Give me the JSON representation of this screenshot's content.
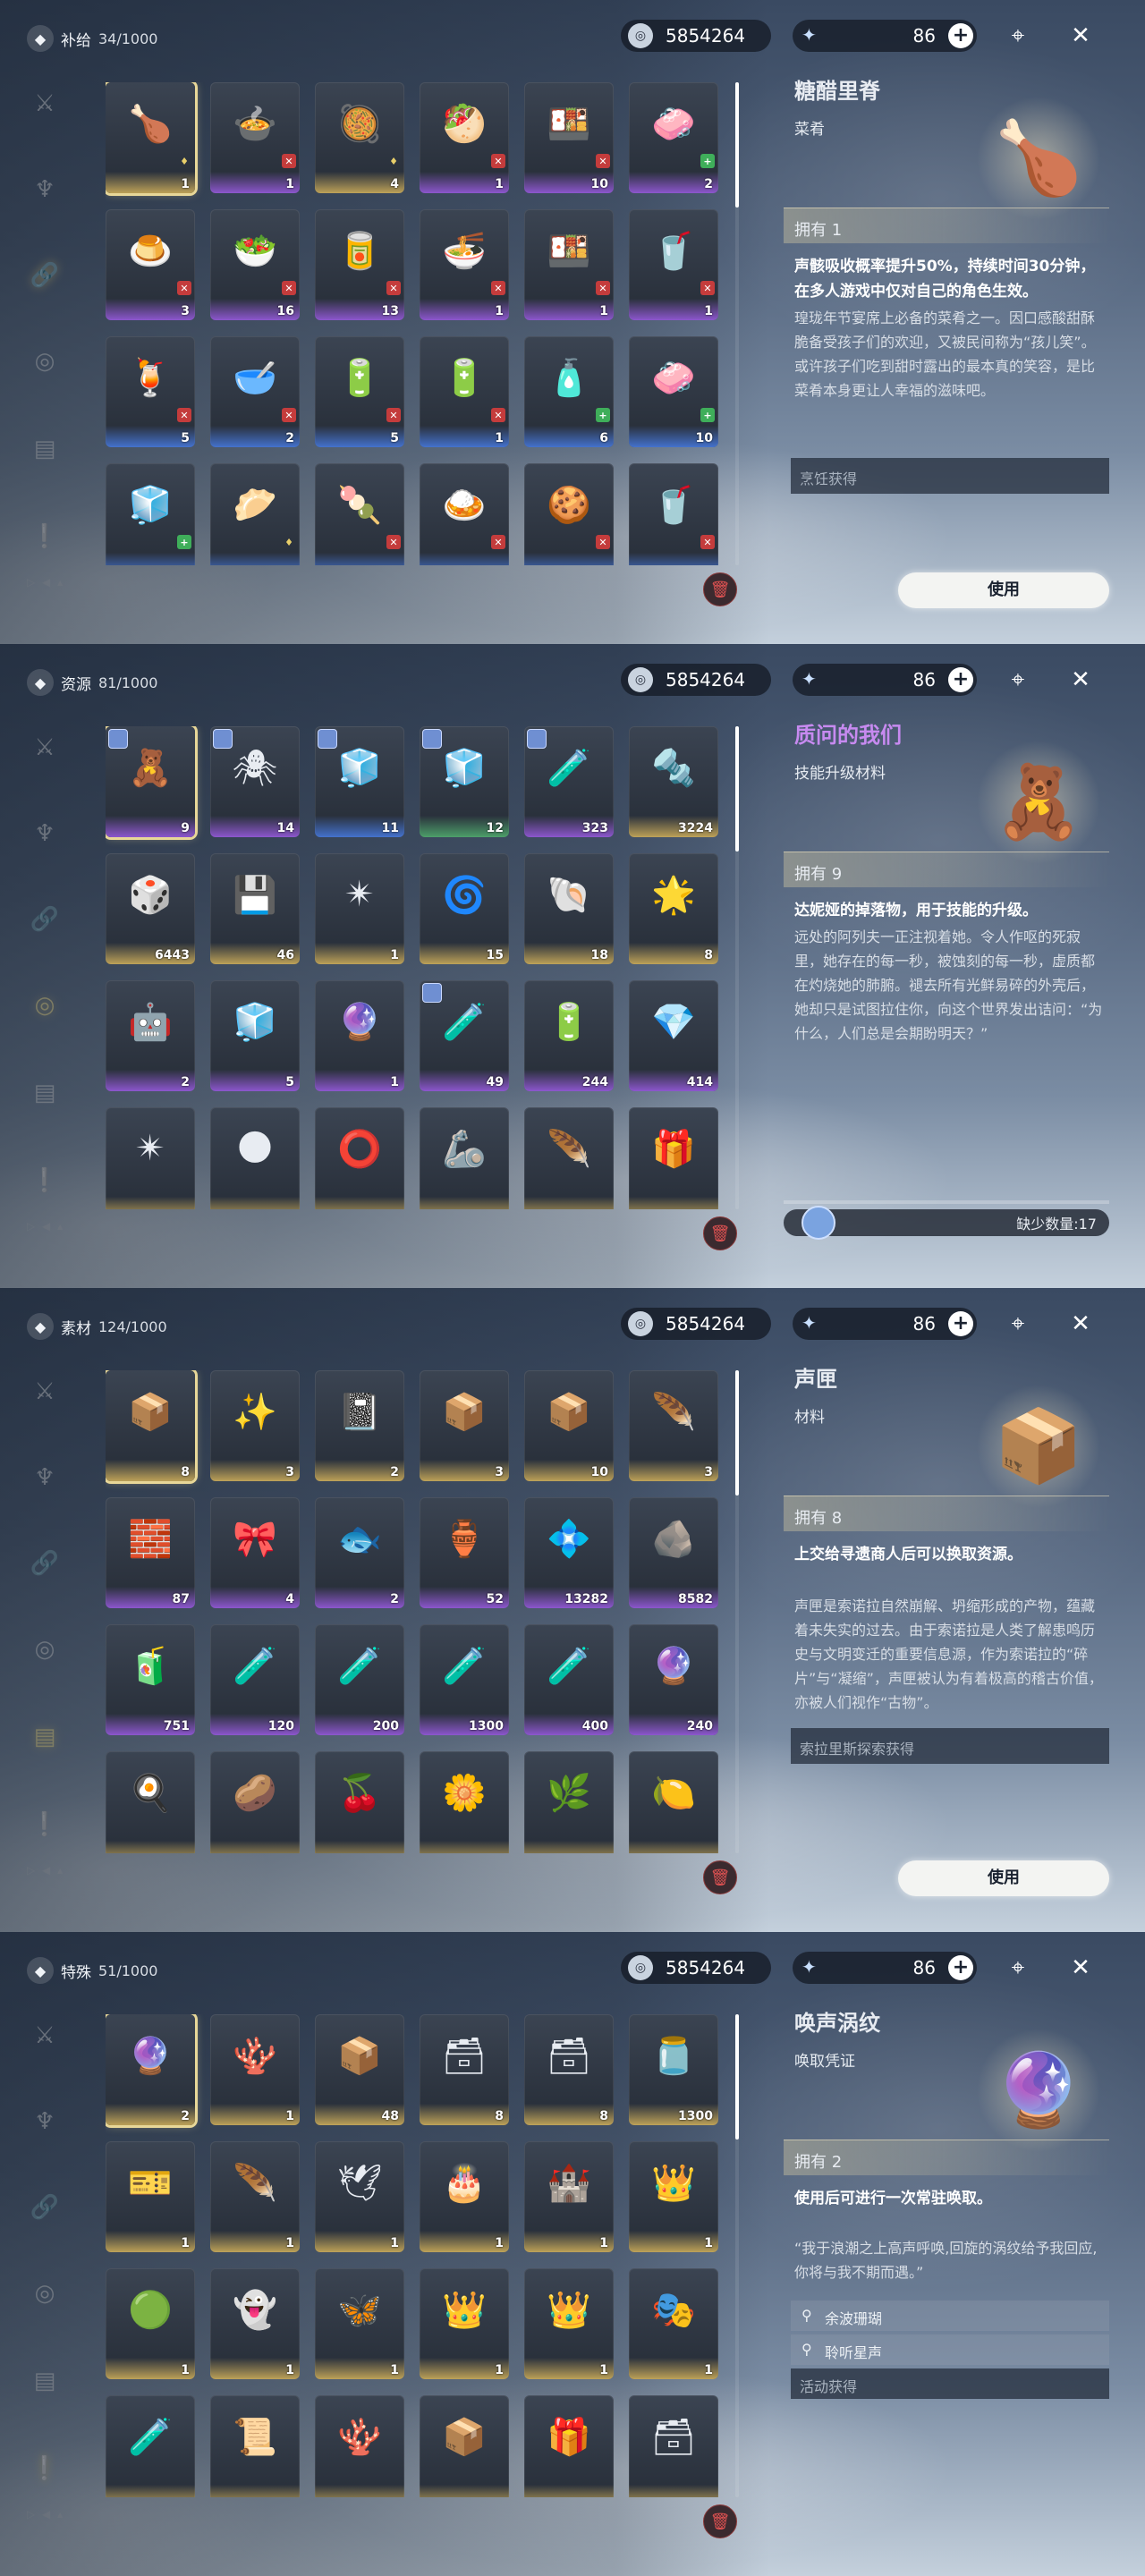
{
  "accent": {
    "gold": "#e8d798",
    "purple_name": "#c78af0",
    "trash": "#e05252"
  },
  "panels": [
    {
      "category": "补给",
      "count": "34/1000",
      "currency": "5854264",
      "stamina": "86",
      "items": [
        {
          "icon": "🍗",
          "qty": "1",
          "q": "gold",
          "b": "gold"
        },
        {
          "icon": "🍲",
          "qty": "1",
          "q": "purple",
          "b": "red"
        },
        {
          "icon": "🥘",
          "qty": "4",
          "q": "gold",
          "b": "gold"
        },
        {
          "icon": "🥙",
          "qty": "1",
          "q": "purple",
          "b": "red"
        },
        {
          "icon": "🍱",
          "qty": "10",
          "q": "purple",
          "b": "red"
        },
        {
          "icon": "🧼",
          "qty": "2",
          "q": "purple",
          "b": "green"
        },
        {
          "icon": "🍮",
          "qty": "3",
          "q": "purple",
          "b": "red"
        },
        {
          "icon": "🥗",
          "qty": "16",
          "q": "purple",
          "b": "red"
        },
        {
          "icon": "🥫",
          "qty": "13",
          "q": "purple",
          "b": "red"
        },
        {
          "icon": "🍜",
          "qty": "1",
          "q": "purple",
          "b": "red"
        },
        {
          "icon": "🍱",
          "qty": "1",
          "q": "purple",
          "b": "red"
        },
        {
          "icon": "🥤",
          "qty": "1",
          "q": "purple",
          "b": "red"
        },
        {
          "icon": "🍹",
          "qty": "5",
          "q": "blue",
          "b": "red"
        },
        {
          "icon": "🥣",
          "qty": "2",
          "q": "blue",
          "b": "red"
        },
        {
          "icon": "🔋",
          "qty": "5",
          "q": "blue",
          "b": "red"
        },
        {
          "icon": "🔋",
          "qty": "1",
          "q": "blue",
          "b": "red"
        },
        {
          "icon": "🧴",
          "qty": "6",
          "q": "blue",
          "b": "green"
        },
        {
          "icon": "🧼",
          "qty": "10",
          "q": "blue",
          "b": "green"
        },
        {
          "icon": "🧊",
          "qty": "",
          "q": "blue",
          "b": "green"
        },
        {
          "icon": "🥟",
          "qty": "",
          "q": "blue",
          "b": "gold"
        },
        {
          "icon": "🍡",
          "qty": "",
          "q": "blue",
          "b": "red"
        },
        {
          "icon": "🍛",
          "qty": "",
          "q": "blue",
          "b": "red"
        },
        {
          "icon": "🍪",
          "qty": "",
          "q": "blue",
          "b": "red"
        },
        {
          "icon": "🥤",
          "qty": "",
          "q": "blue",
          "b": "red"
        }
      ],
      "detail": {
        "name": "糖醋里脊",
        "type": "菜肴",
        "img": "🍗",
        "owned": "拥有 1",
        "effect": "声骸吸收概率提升50%，持续时间30分钟，在多人游戏中仅对自己的角色生效。",
        "desc": "瑝珑年节宴席上必备的菜肴之一。因口感酸甜酥脆备受孩子们的欢迎，又被民间称为“孩儿笑”。或许孩子们吃到甜时露出的最本真的笑容，是比菜肴本身更让人幸福的滋味吧。",
        "source": "烹饪获得",
        "use": "使用"
      }
    },
    {
      "category": "资源",
      "count": "81/1000",
      "currency": "5854264",
      "stamina": "86",
      "items": [
        {
          "icon": "🧸",
          "qty": "9",
          "q": "purple",
          "t": true
        },
        {
          "icon": "🕷",
          "qty": "14",
          "q": "purple",
          "t": true
        },
        {
          "icon": "🧊",
          "qty": "11",
          "q": "blue",
          "t": true
        },
        {
          "icon": "🧊",
          "qty": "12",
          "q": "green",
          "t": true
        },
        {
          "icon": "🧪",
          "qty": "323",
          "q": "purple",
          "t": true
        },
        {
          "icon": "🔩",
          "qty": "3224",
          "q": "gold"
        },
        {
          "icon": "🎲",
          "qty": "6443",
          "q": "gold"
        },
        {
          "icon": "💾",
          "qty": "46",
          "q": "gold"
        },
        {
          "icon": "✴",
          "qty": "1",
          "q": "gold"
        },
        {
          "icon": "🌀",
          "qty": "15",
          "q": "gold"
        },
        {
          "icon": "🐚",
          "qty": "18",
          "q": "gold"
        },
        {
          "icon": "🌟",
          "qty": "8",
          "q": "gold"
        },
        {
          "icon": "🤖",
          "qty": "2",
          "q": "purple"
        },
        {
          "icon": "🧊",
          "qty": "5",
          "q": "purple"
        },
        {
          "icon": "🔮",
          "qty": "1",
          "q": "purple"
        },
        {
          "icon": "🧪",
          "qty": "49",
          "q": "purple",
          "t": true
        },
        {
          "icon": "🔋",
          "qty": "244",
          "q": "purple"
        },
        {
          "icon": "💎",
          "qty": "414",
          "q": "purple"
        },
        {
          "icon": "✴",
          "qty": "",
          "q": "gold"
        },
        {
          "icon": "🌑",
          "qty": "",
          "q": "gold"
        },
        {
          "icon": "⭕",
          "qty": "",
          "q": "gold"
        },
        {
          "icon": "🦾",
          "qty": "",
          "q": "gold"
        },
        {
          "icon": "🪶",
          "qty": "",
          "q": "gold"
        },
        {
          "icon": "🎁",
          "qty": "",
          "q": "gold"
        }
      ],
      "detail": {
        "name": "质问的我们",
        "type": "技能升级材料",
        "img": "🧸",
        "owned": "拥有 9",
        "effect": "达妮娅的掉落物，用于技能的升级。",
        "desc": "远处的阿列夫一正注视着她。令人作呕的死寂里，她存在的每一秒，被蚀刻的每一秒，虚质都在灼烧她的肺腑。褪去所有光鲜易碎的外壳后，她却只是试图拉住你，向这个世界发出诘问：“为什么，人们总是会期盼明天？”",
        "lack": "缺少数量:17"
      }
    },
    {
      "category": "素材",
      "count": "124/1000",
      "currency": "5854264",
      "stamina": "86",
      "items": [
        {
          "icon": "📦",
          "qty": "8",
          "q": "gold"
        },
        {
          "icon": "✨",
          "qty": "3",
          "q": "gold"
        },
        {
          "icon": "📓",
          "qty": "2",
          "q": "gold"
        },
        {
          "icon": "📦",
          "qty": "3",
          "q": "gold"
        },
        {
          "icon": "📦",
          "qty": "10",
          "q": "gold"
        },
        {
          "icon": "🪶",
          "qty": "3",
          "q": "gold"
        },
        {
          "icon": "🧱",
          "qty": "87",
          "q": "purple"
        },
        {
          "icon": "🎀",
          "qty": "4",
          "q": "purple"
        },
        {
          "icon": "🐟",
          "qty": "2",
          "q": "purple"
        },
        {
          "icon": "🏺",
          "qty": "52",
          "q": "purple"
        },
        {
          "icon": "💠",
          "qty": "13282",
          "q": "purple"
        },
        {
          "icon": "🪨",
          "qty": "8582",
          "q": "purple"
        },
        {
          "icon": "🧃",
          "qty": "751",
          "q": "purple"
        },
        {
          "icon": "🧪",
          "qty": "120",
          "q": "purple"
        },
        {
          "icon": "🧪",
          "qty": "200",
          "q": "purple"
        },
        {
          "icon": "🧪",
          "qty": "1300",
          "q": "purple"
        },
        {
          "icon": "🧪",
          "qty": "400",
          "q": "purple"
        },
        {
          "icon": "🔮",
          "qty": "240",
          "q": "purple"
        },
        {
          "icon": "🍳",
          "qty": "",
          "q": "gold"
        },
        {
          "icon": "🥔",
          "qty": "",
          "q": "gold"
        },
        {
          "icon": "🍒",
          "qty": "",
          "q": "gold"
        },
        {
          "icon": "🌼",
          "qty": "",
          "q": "gold"
        },
        {
          "icon": "🌿",
          "qty": "",
          "q": "gold"
        },
        {
          "icon": "🍋",
          "qty": "",
          "q": "gold"
        }
      ],
      "detail": {
        "name": "声匣",
        "type": "材料",
        "img": "📦",
        "owned": "拥有 8",
        "effect": "上交给寻遗商人后可以换取资源。",
        "desc": "声匣是索诺拉自然崩解、坍缩形成的产物，蕴藏着未失实的过去。由于索诺拉是人类了解患鸣历史与文明变迁的重要信息源，作为索诺拉的“碎片”与“凝缩”，声匣被认为有着极高的稽古价值，亦被人们视作“古物”。",
        "source": "索拉里斯探索获得",
        "use": "使用"
      }
    },
    {
      "category": "特殊",
      "count": "51/1000",
      "currency": "5854264",
      "stamina": "86",
      "items": [
        {
          "icon": "🔮",
          "qty": "2",
          "q": "gold"
        },
        {
          "icon": "🪸",
          "qty": "1",
          "q": "gold"
        },
        {
          "icon": "📦",
          "qty": "48",
          "q": "gold"
        },
        {
          "icon": "🗃",
          "qty": "8",
          "q": "gold"
        },
        {
          "icon": "🗃",
          "qty": "8",
          "q": "gold"
        },
        {
          "icon": "🫙",
          "qty": "1300",
          "q": "gold"
        },
        {
          "icon": "🎫",
          "qty": "1",
          "q": "gold"
        },
        {
          "icon": "🪶",
          "qty": "1",
          "q": "gold"
        },
        {
          "icon": "🕊",
          "qty": "1",
          "q": "gold"
        },
        {
          "icon": "🎂",
          "qty": "1",
          "q": "gold"
        },
        {
          "icon": "🏰",
          "qty": "1",
          "q": "gold"
        },
        {
          "icon": "👑",
          "qty": "1",
          "q": "gold"
        },
        {
          "icon": "🟢",
          "qty": "1",
          "q": "gold"
        },
        {
          "icon": "👻",
          "qty": "1",
          "q": "gold"
        },
        {
          "icon": "🦋",
          "qty": "1",
          "q": "gold"
        },
        {
          "icon": "👑",
          "qty": "1",
          "q": "gold"
        },
        {
          "icon": "👑",
          "qty": "1",
          "q": "gold"
        },
        {
          "icon": "🎭",
          "qty": "1",
          "q": "gold"
        },
        {
          "icon": "🧪",
          "qty": "",
          "q": "gold"
        },
        {
          "icon": "📜",
          "qty": "",
          "q": "gold"
        },
        {
          "icon": "🪸",
          "qty": "",
          "q": "gold"
        },
        {
          "icon": "📦",
          "qty": "",
          "q": "gold"
        },
        {
          "icon": "🎁",
          "qty": "",
          "q": "gold"
        },
        {
          "icon": "🗃",
          "qty": "",
          "q": "gold"
        }
      ],
      "detail": {
        "name": "唤声涡纹",
        "type": "唤取凭证",
        "img": "🔮",
        "owned": "拥有 2",
        "effect": "使用后可进行一次常驻唤取。",
        "desc": "“我于浪潮之上高声呼唤,回旋的涡纹给予我回应,你将与我不期而遇。”",
        "sources": [
          "余波珊瑚",
          "聆听星声",
          "活动获得"
        ]
      }
    }
  ]
}
